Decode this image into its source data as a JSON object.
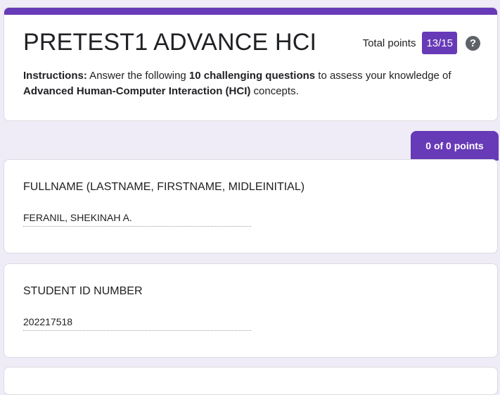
{
  "form": {
    "title": "PRETEST1 ADVANCE HCI",
    "total_points_label": "Total points",
    "score": "13/15",
    "help_icon": "question-circle-icon",
    "instructions": {
      "lead": "Instructions:",
      "part1": " Answer the following ",
      "bold1": "10 challenging questions",
      "part2": " to assess your knowledge of ",
      "bold2": "Advanced Human-Computer Interaction (HCI)",
      "part3": " concepts."
    },
    "accent_color": "#673ab7"
  },
  "section": {
    "points": "0 of 0 points"
  },
  "questions": [
    {
      "title": "FULLNAME (LASTNAME, FIRSTNAME, MIDLEINITIAL)",
      "answer": "FERANIL, SHEKINAH A."
    },
    {
      "title": "STUDENT ID NUMBER",
      "answer": "202217518"
    }
  ]
}
